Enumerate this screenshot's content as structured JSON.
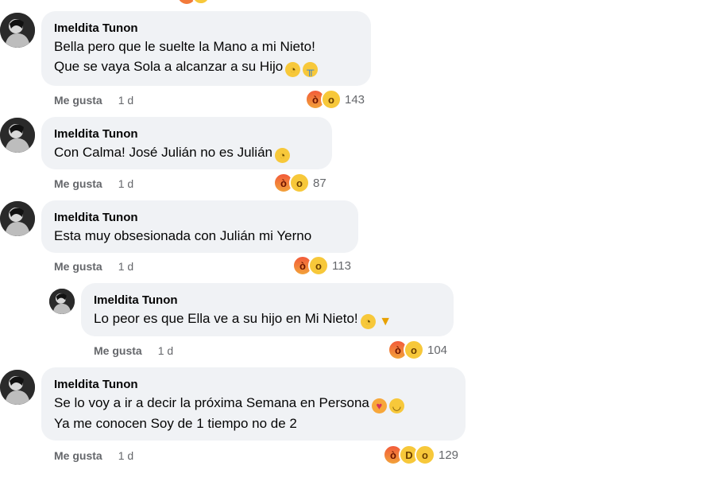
{
  "comments": [
    {
      "author": "Imeldita Tunon",
      "line1": "Bella pero que le suelte la Mano a mi Nieto!",
      "line2": "Que se vaya Sola a alcanzar a su Hijo",
      "like_label": "Me gusta",
      "time": "1 d",
      "reaction_count": "143",
      "reactions": [
        "angry-icon",
        "wow-icon"
      ]
    },
    {
      "author": "Imeldita Tunon",
      "line1": "Con Calma! José Julián no es Julián",
      "like_label": "Me gusta",
      "time": "1 d",
      "reaction_count": "87",
      "reactions": [
        "angry-icon",
        "wow-icon"
      ]
    },
    {
      "author": "Imeldita Tunon",
      "line1": "Esta muy obsesionada con Julián mi Yerno",
      "like_label": "Me gusta",
      "time": "1 d",
      "reaction_count": "113",
      "reactions": [
        "angry-icon",
        "wow-icon"
      ]
    },
    {
      "author": "Imeldita Tunon",
      "line1": "Lo peor es que Ella ve a su hijo en Mi Nieto!",
      "like_label": "Me gusta",
      "time": "1 d",
      "reaction_count": "104",
      "reactions": [
        "angry-icon",
        "wow-icon"
      ]
    },
    {
      "author": "Imeldita Tunon",
      "line1": "Se lo voy a ir a decir la próxima Semana en Persona",
      "line2": "Ya me conocen Soy de 1 tiempo no de 2",
      "like_label": "Me gusta",
      "time": "1 d",
      "reaction_count": "129",
      "reactions": [
        "angry-icon",
        "haha-icon",
        "wow-icon"
      ]
    }
  ],
  "colors": {
    "bubble": "#f0f2f5",
    "meta_text": "#65676b",
    "text": "#050505"
  }
}
